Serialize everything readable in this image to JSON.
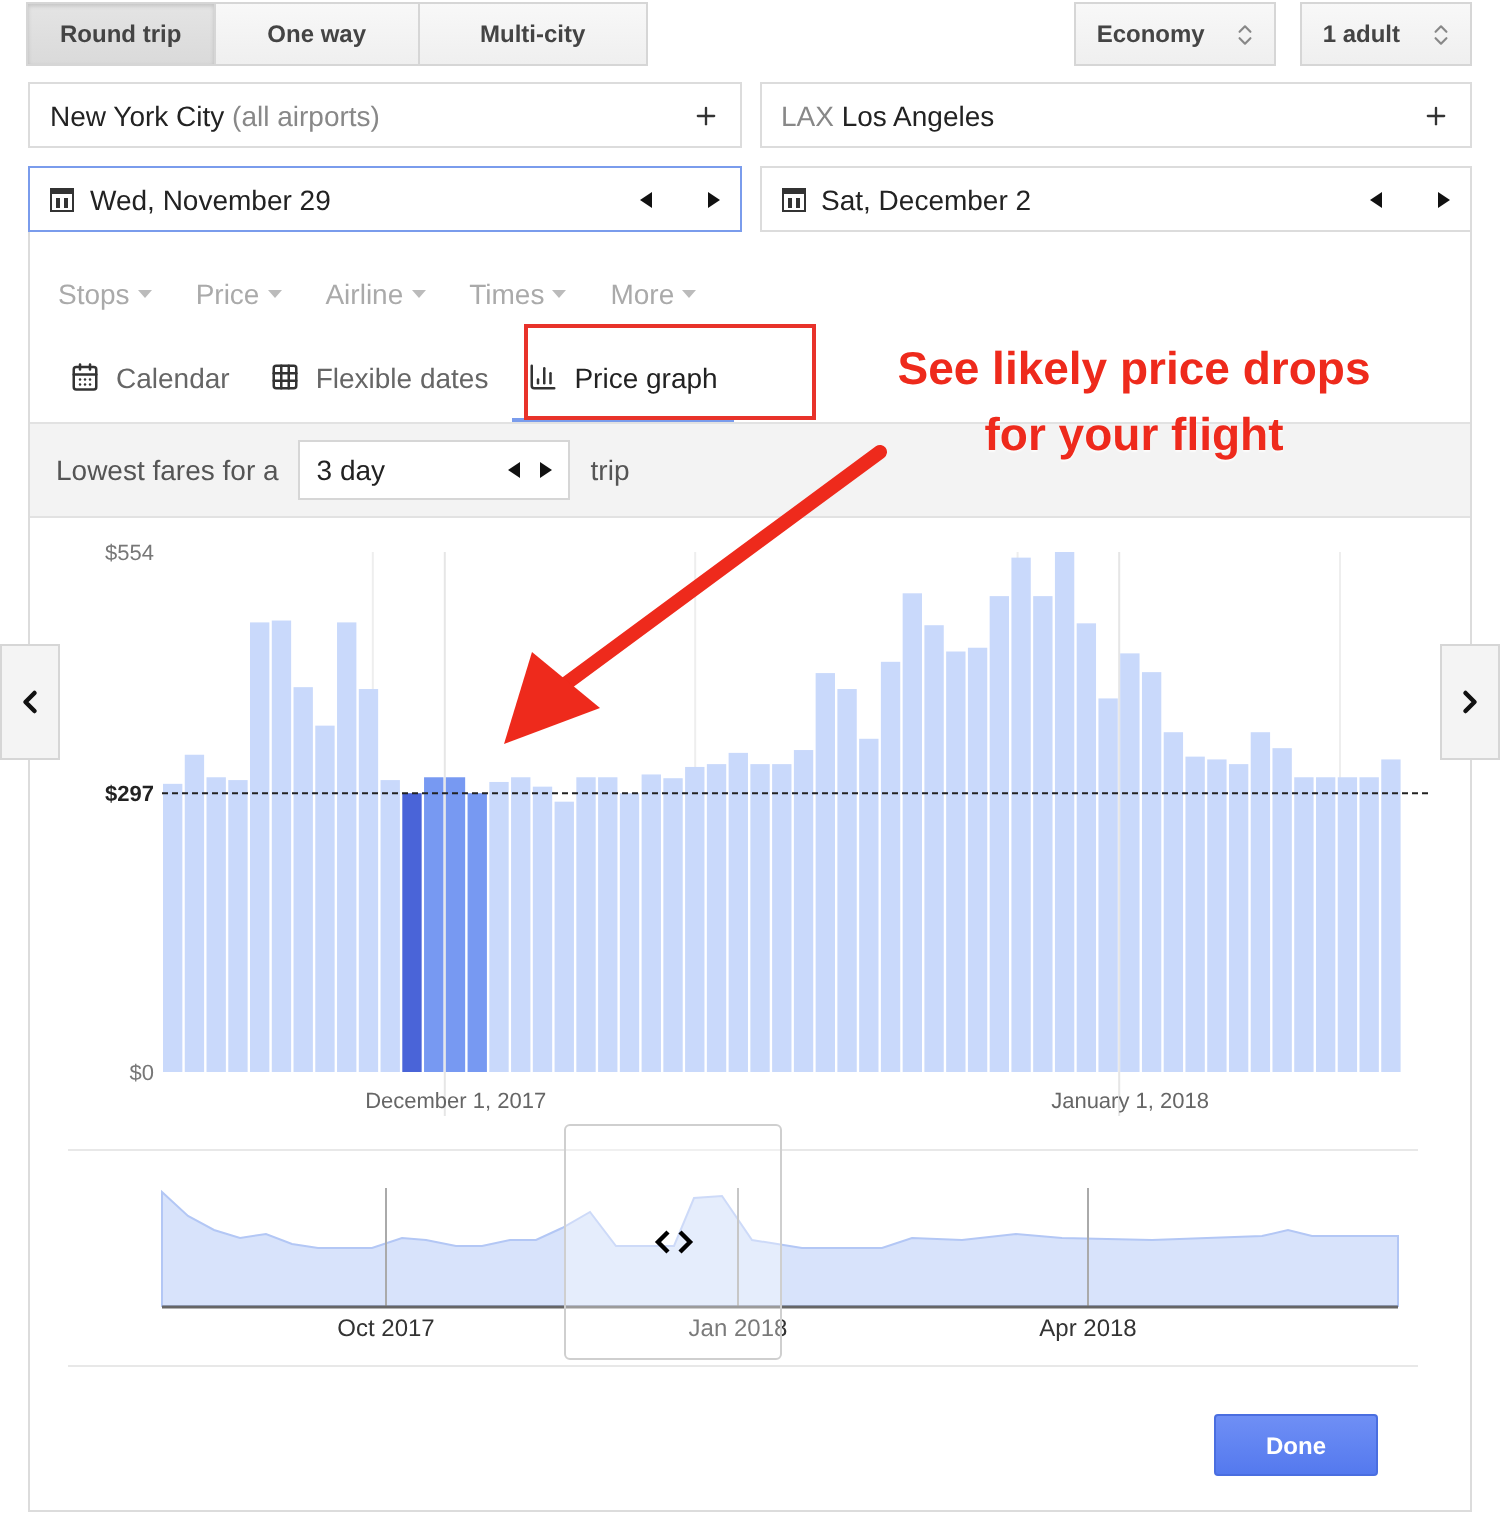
{
  "trip_types": [
    {
      "label": "Round trip",
      "selected": true
    },
    {
      "label": "One way",
      "selected": false
    },
    {
      "label": "Multi-city",
      "selected": false
    }
  ],
  "cabin": {
    "value": "Economy"
  },
  "passengers": {
    "value": "1 adult"
  },
  "origin": {
    "city": "New York City",
    "note": "(all airports)"
  },
  "destination": {
    "code": "LAX",
    "city": "Los Angeles"
  },
  "dates": [
    {
      "value": "Wed, November 29",
      "focused": true
    },
    {
      "value": "Sat, December 2",
      "focused": false
    }
  ],
  "filters": [
    {
      "label": "Stops",
      "disabled": true
    },
    {
      "label": "Price",
      "disabled": true
    },
    {
      "label": "Airline",
      "disabled": true
    },
    {
      "label": "Times",
      "disabled": true
    },
    {
      "label": "More",
      "disabled": true
    }
  ],
  "views": [
    {
      "label": "Calendar",
      "selected": false
    },
    {
      "label": "Flexible dates",
      "selected": false
    },
    {
      "label": "Price graph",
      "selected": true
    }
  ],
  "fare_span": {
    "label": "Lowest fares for a",
    "value": "3 day",
    "suffix": "trip"
  },
  "price_graph": {
    "chart_data": {
      "type": "bar",
      "categories": [
        null,
        null,
        null,
        null,
        null,
        null,
        null,
        null,
        null,
        null,
        null,
        null,
        null,
        "December 1, 2017",
        null,
        null,
        null,
        null,
        null,
        null,
        null,
        null,
        null,
        null,
        null,
        null,
        null,
        null,
        null,
        null,
        null,
        null,
        null,
        null,
        null,
        null,
        null,
        null,
        null,
        null,
        null,
        null,
        null,
        null,
        "January 1, 2018",
        null,
        null,
        null,
        null,
        null,
        null,
        null,
        null,
        null,
        null,
        null,
        null
      ],
      "stacked": true,
      "grid": true,
      "series": [
        {
          "color": "#c9d9fb",
          "values": [
            307,
            338,
            314,
            311,
            479,
            481,
            410,
            369,
            479,
            408,
            311,
            null,
            null,
            null,
            null,
            309,
            314,
            304,
            288,
            314,
            314,
            297,
            317,
            313,
            325,
            328,
            340,
            328,
            328,
            343,
            425,
            408,
            355,
            437,
            510,
            476,
            448,
            452,
            507,
            548,
            507,
            554,
            478,
            398,
            446,
            426,
            362,
            336,
            333,
            328,
            362,
            345,
            314,
            314,
            314,
            314,
            333
          ]
        },
        {
          "color": "#7799f2",
          "values": [
            null,
            null,
            null,
            null,
            null,
            null,
            null,
            null,
            null,
            null,
            null,
            null,
            314,
            314,
            297,
            null,
            null,
            null,
            null,
            null,
            null,
            null,
            null,
            null,
            null,
            null,
            null,
            null,
            null,
            null,
            null,
            null,
            null,
            null,
            null,
            null,
            null,
            null,
            null,
            null,
            null,
            null,
            null,
            null,
            null,
            null,
            null,
            null,
            null,
            null,
            null,
            null,
            null,
            null,
            null,
            null,
            null
          ]
        },
        {
          "color": "#4a64d8",
          "values": [
            null,
            null,
            null,
            null,
            null,
            null,
            null,
            null,
            null,
            null,
            null,
            297,
            null,
            null,
            null,
            null,
            null,
            null,
            null,
            null,
            null,
            null,
            null,
            null,
            null,
            null,
            null,
            null,
            null,
            null,
            null,
            null,
            null,
            null,
            null,
            null,
            null,
            null,
            null,
            null,
            null,
            null,
            null,
            null,
            null,
            null,
            null,
            null,
            null,
            null,
            null,
            null,
            null,
            null,
            null,
            null,
            null
          ]
        }
      ],
      "ylim": [
        0,
        554
      ],
      "yticks": [
        {
          "value": 0,
          "label": "$0"
        },
        {
          "value": 554,
          "label": "$554"
        }
      ],
      "ref_lines": [
        {
          "axis": "y",
          "value": 297,
          "label": "$297"
        }
      ]
    }
  },
  "overview": {
    "labels": [
      "Oct 2017",
      "Jan 2018",
      "Apr 2018"
    ]
  },
  "callout": {
    "text": "See likely price drops for your flight"
  },
  "done_button": {
    "label": "Done"
  }
}
